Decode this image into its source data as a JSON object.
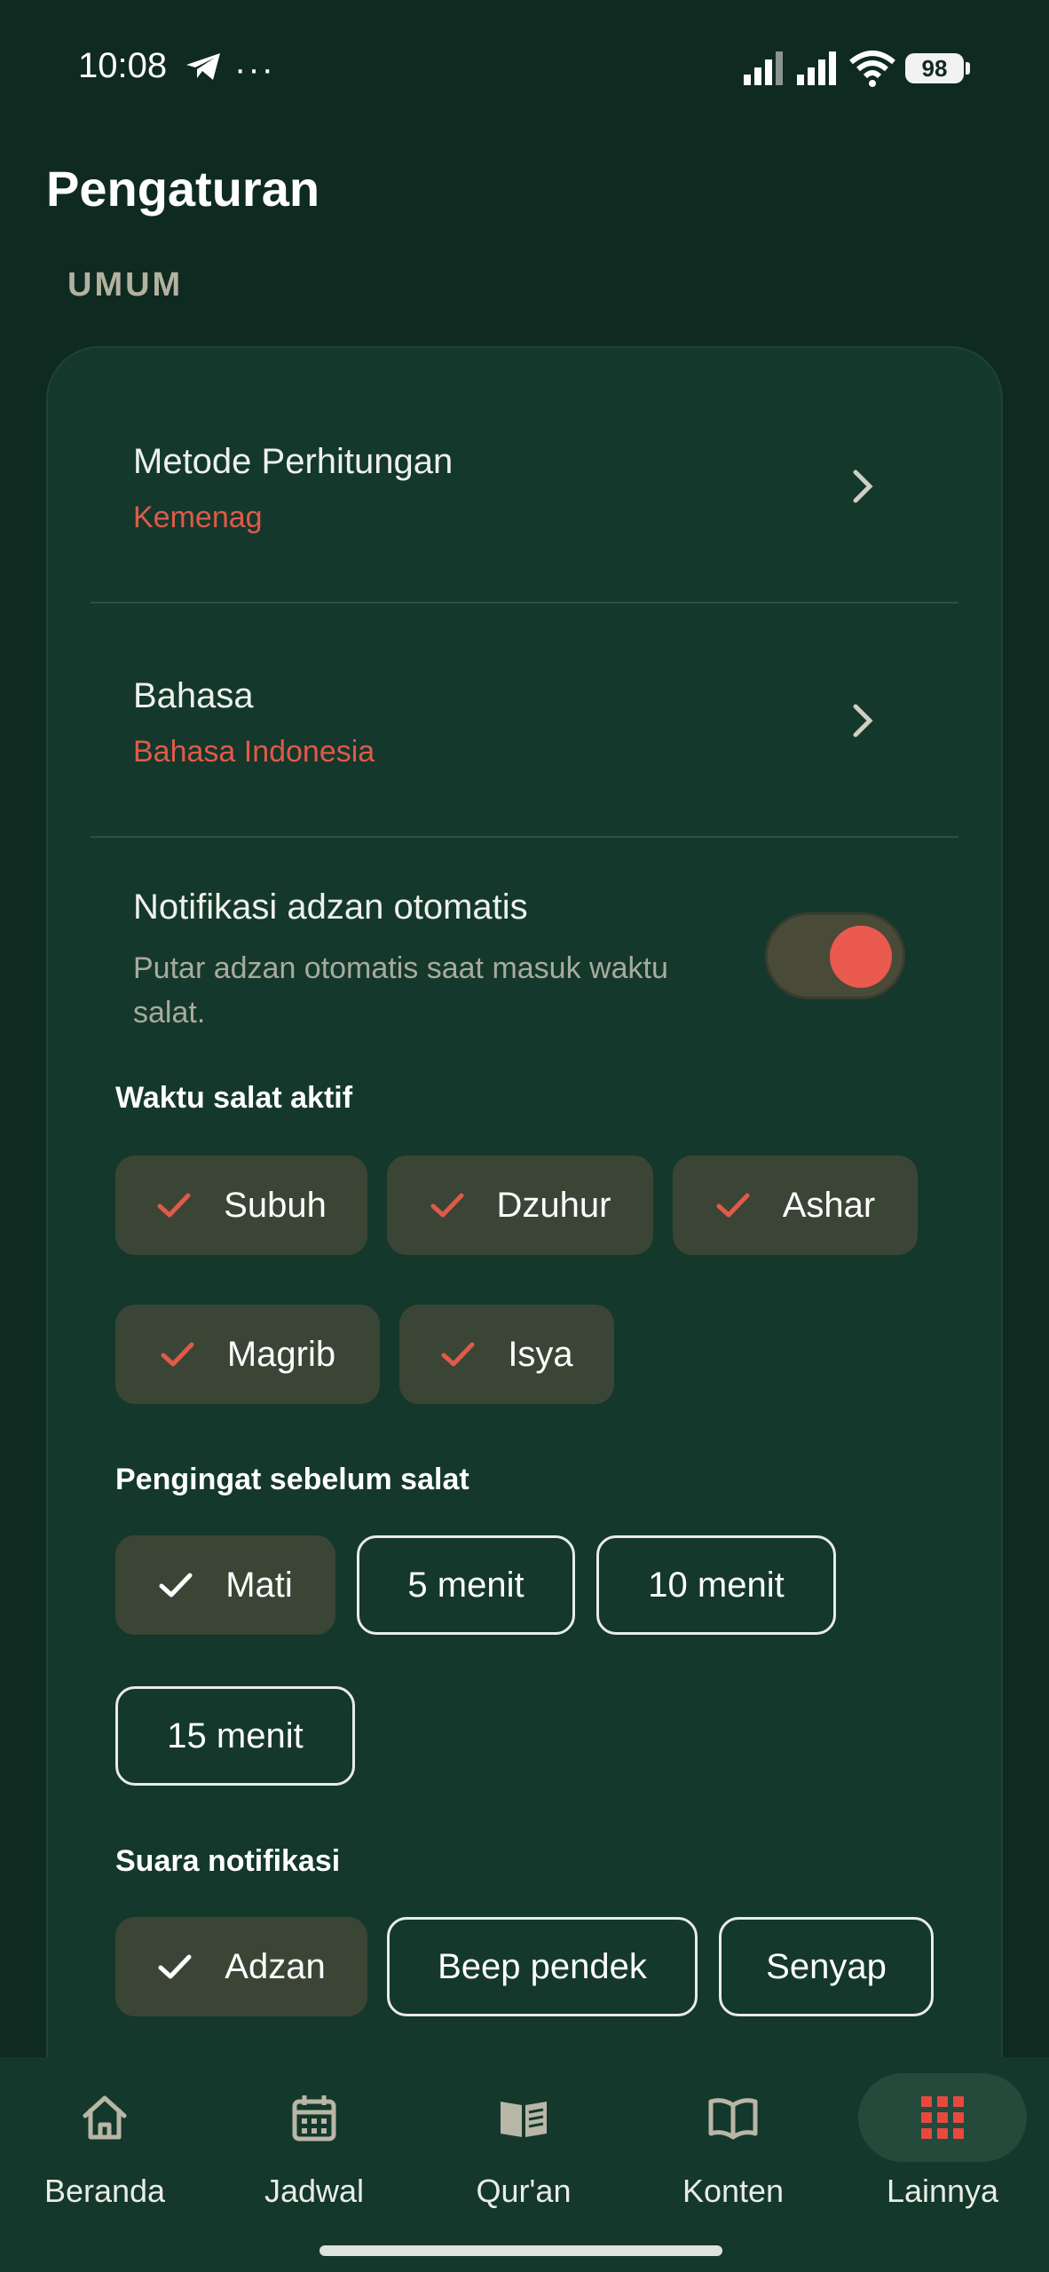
{
  "status_bar": {
    "time": "10:08",
    "more": "···",
    "battery": "98"
  },
  "header": {
    "title": "Pengaturan",
    "section": "UMUM"
  },
  "settings": {
    "method": {
      "title": "Metode Perhitungan",
      "value": "Kemenag"
    },
    "language": {
      "title": "Bahasa",
      "value": "Bahasa Indonesia"
    },
    "auto_adzan": {
      "title": "Notifikasi adzan otomatis",
      "description": "Putar adzan otomatis saat masuk waktu salat.",
      "enabled": true
    }
  },
  "prayer_times": {
    "label": "Waktu salat aktif",
    "options": [
      "Subuh",
      "Dzuhur",
      "Ashar",
      "Magrib",
      "Isya"
    ]
  },
  "reminder": {
    "label": "Pengingat sebelum salat",
    "options": [
      "Mati",
      "5 menit",
      "10 menit",
      "15 menit"
    ],
    "selected": "Mati"
  },
  "sound": {
    "label": "Suara notifikasi",
    "options": [
      "Adzan",
      "Beep pendek",
      "Senyap"
    ],
    "selected": "Adzan"
  },
  "bottom_nav": {
    "items": [
      "Beranda",
      "Jadwal",
      "Qur'an",
      "Konten",
      "Lainnya"
    ],
    "active": "Lainnya"
  },
  "colors": {
    "background": "#0f2a21",
    "card": "#14382b",
    "accent": "#e05a4a",
    "chip_selected": "#3b4535"
  }
}
